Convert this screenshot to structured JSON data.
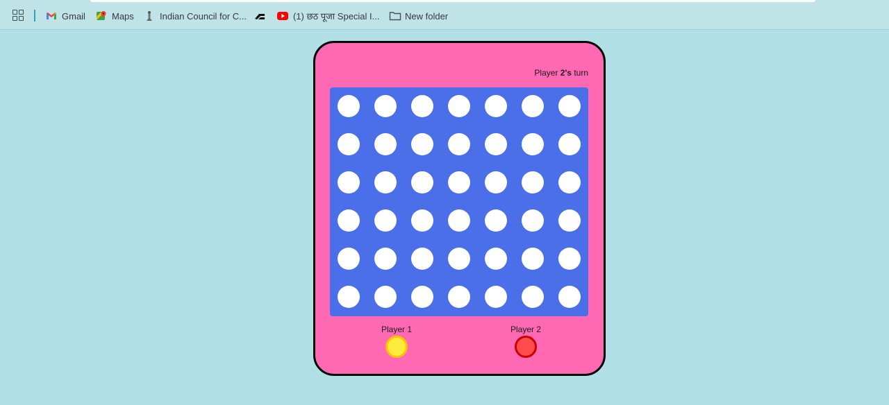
{
  "bookmarks": {
    "items": [
      {
        "label": "Gmail",
        "icon": "gmail-icon"
      },
      {
        "label": "Maps",
        "icon": "maps-icon"
      },
      {
        "label": "Indian Council for C...",
        "icon": "icc-icon"
      },
      {
        "label": "",
        "icon": "arc-icon"
      },
      {
        "label": "(1) छठ पूजा Special I...",
        "icon": "youtube-icon"
      },
      {
        "label": "New folder",
        "icon": "folder-icon"
      }
    ]
  },
  "game": {
    "turn_prefix": "Player ",
    "turn_player": "2's",
    "turn_suffix": " turn",
    "rows": 6,
    "cols": 7,
    "board": [
      [
        "",
        "",
        "",
        "",
        "",
        "",
        ""
      ],
      [
        "",
        "",
        "",
        "",
        "",
        "",
        ""
      ],
      [
        "",
        "",
        "",
        "",
        "",
        "",
        ""
      ],
      [
        "",
        "",
        "",
        "",
        "",
        "",
        ""
      ],
      [
        "",
        "",
        "",
        "",
        "",
        "",
        ""
      ],
      [
        "",
        "",
        "",
        "",
        "",
        "",
        ""
      ]
    ],
    "players": [
      {
        "label": "Player 1",
        "color": "#ffeb3b",
        "ring": "#ffc107"
      },
      {
        "label": "Player 2",
        "color": "#ff4c4c",
        "ring": "#cc0000"
      }
    ],
    "colors": {
      "frame": "#ff69b4",
      "grid": "#4a6fe8",
      "empty_cell": "#ffffff",
      "background": "#b0dfe5"
    }
  }
}
